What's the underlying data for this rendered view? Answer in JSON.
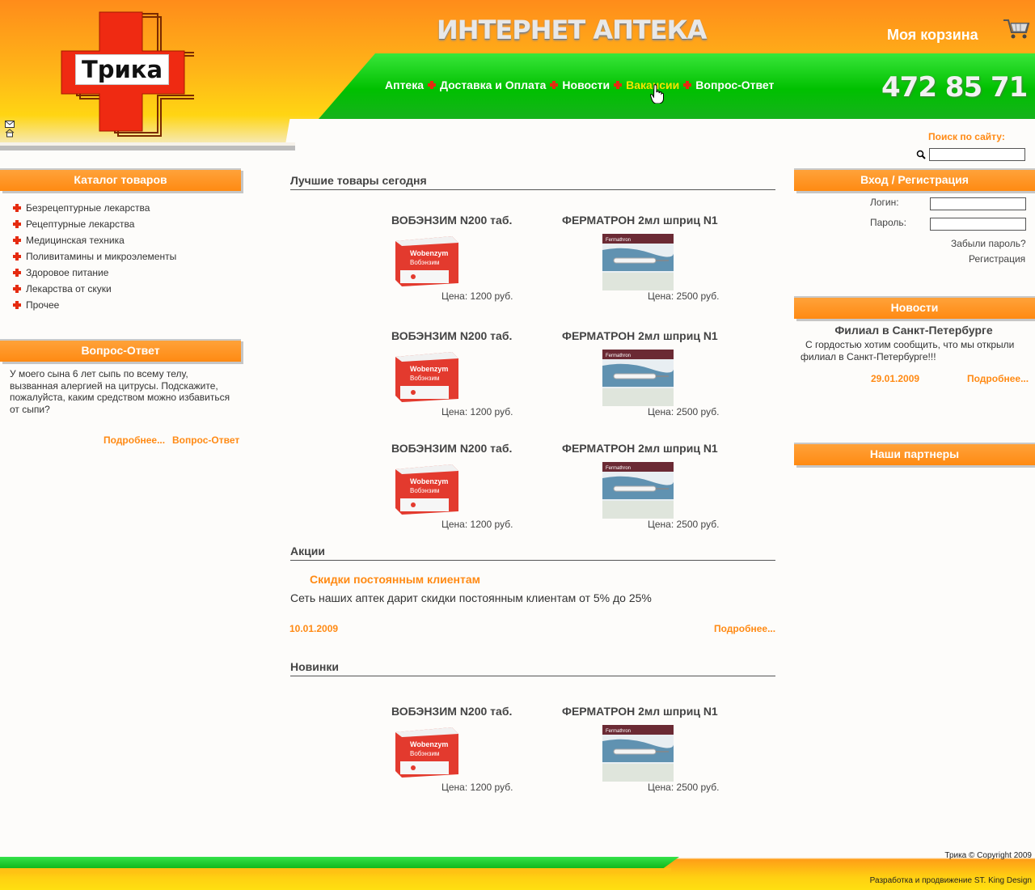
{
  "header": {
    "logo_text": "Трика",
    "site_title": "ИНТЕРНЕТ АПТЕКА",
    "cart_label": "Моя корзина",
    "phone": "472 85 71",
    "nav": [
      "Аптека",
      "Доставка и Оплата",
      "Новости",
      "Вакансии",
      "Вопрос-Ответ"
    ],
    "active_nav": "Вакансии",
    "icons": [
      "mail-icon",
      "home-icon",
      "cart-icon",
      "hand-cursor-icon"
    ]
  },
  "search": {
    "label": "Поиск по сайту:",
    "value": ""
  },
  "left": {
    "catalog_title": "Каталог товаров",
    "catalog": [
      "Безрецептурные лекарства",
      "Рецептурные лекарства",
      "Медицинская техника",
      "Поливитамины и микроэлементы",
      "Здоровое питание",
      "Лекарства от скуки",
      "Прочее"
    ],
    "qa_title": "Вопрос-Ответ",
    "qa_text": "У моего сына 6 лет сыпь по всему телу, вызванная алергией на цитрусы. Подскажите, пожалуйста,  каким средством можно избавиться от сыпи?",
    "qa_more": "Подробнее...",
    "qa_link": "Вопрос-Ответ"
  },
  "center": {
    "best_title": "Лучшие товары сегодня",
    "product_a": {
      "name": "ВОБЭНЗИМ N200 таб.",
      "price": "Цена: 1200 руб.",
      "box_brand": "Wobenzym",
      "box_sub": "Вобэнзим"
    },
    "product_b": {
      "name": "ФЕРМАТРОН 2мл шприц N1",
      "price": "Цена: 2500 руб.",
      "box_brand": "Fermathron"
    },
    "promo_section": "Акции",
    "promo_title": "Скидки постоянным клиентам",
    "promo_text": "Сеть наших аптек дарит скидки постоянным клиентам от 5% до 25%",
    "promo_date": "10.01.2009",
    "promo_more": "Подробнее...",
    "new_title": "Новинки"
  },
  "right": {
    "login_title": "Вход / Регистрация",
    "login_label": "Логин:",
    "password_label": "Пароль:",
    "forgot": "Забыли пароль?",
    "register": "Регистрация",
    "news_title": "Новости",
    "news_item_title": "Филиал в Санкт-Петербурге",
    "news_item_text": "С гордостью хотим сообщить, что мы открыли филиал в Санкт-Петербурге!!!",
    "news_date": "29.01.2009",
    "news_more": "Подробнее...",
    "partners_title": "Наши партнеры"
  },
  "footer": {
    "copyright": "Трика © Copyright 2009",
    "credits": "Разработка и продвижение ST. King Design"
  },
  "colors": {
    "orange": "#ff8a14",
    "green": "#00c000",
    "red": "#ef2a12"
  }
}
